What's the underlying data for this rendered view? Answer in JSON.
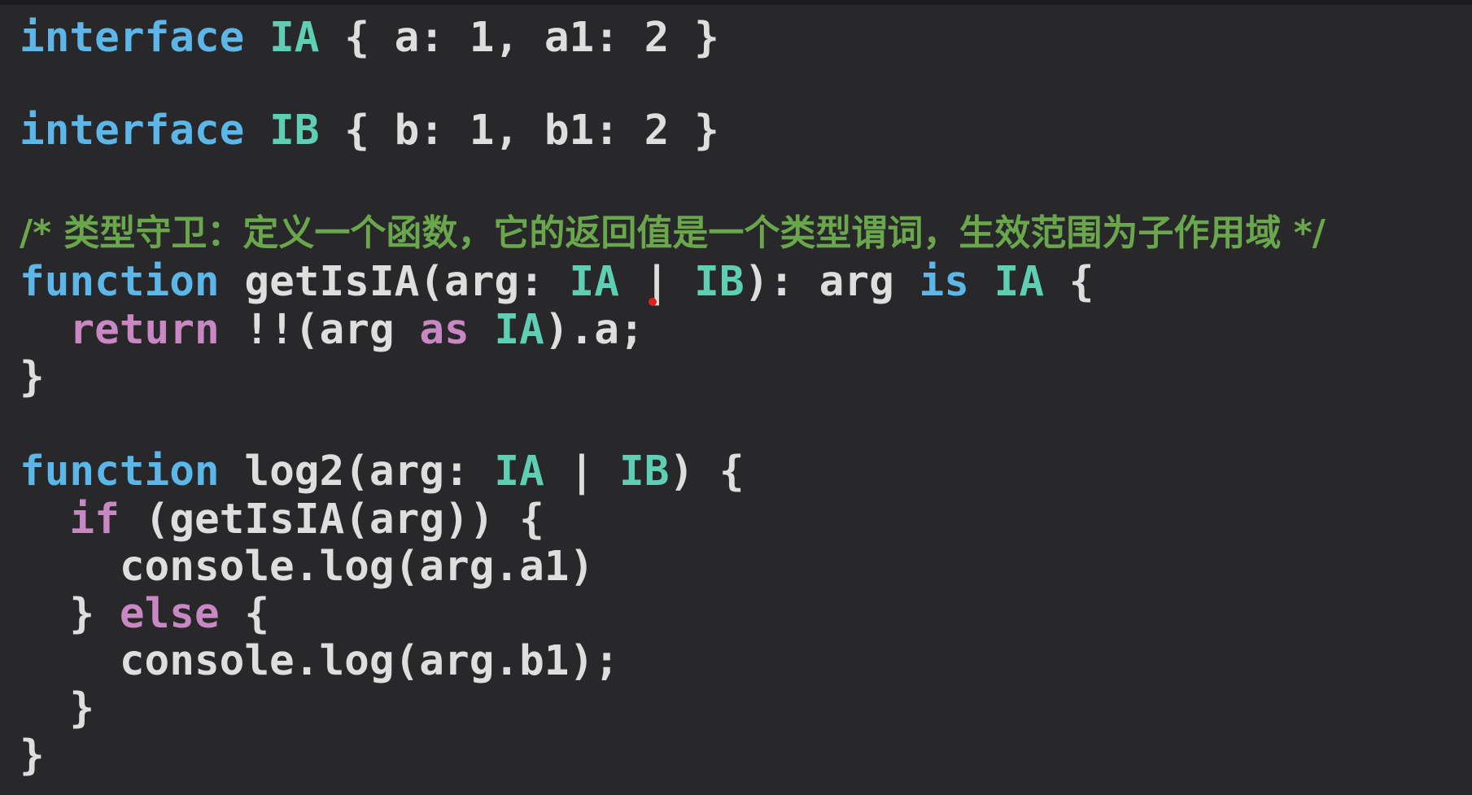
{
  "code": {
    "line1": {
      "kw": "interface",
      "type": "IA",
      "body": "{ a: 1, a1: 2 }"
    },
    "line2": {
      "kw": "interface",
      "type": "IB",
      "body": "{ b: 1, b1: 2 }"
    },
    "line3": {
      "comment": "/* 类型守卫：定义一个函数，它的返回值是一个类型谓词，生效范围为子作用域 */"
    },
    "line4": {
      "kw": "function",
      "name": "getIsIA(arg:",
      "t1": "IA",
      "sep": "|",
      "t2": "IB",
      "mid": "): arg",
      "is": "is",
      "t3": "IA",
      "end": "{"
    },
    "line5": {
      "ret": "return",
      "a": "!!(arg",
      "as": "as",
      "t": "IA",
      "b": ").a;"
    },
    "line6": {
      "close": "}"
    },
    "line7": {
      "kw": "function",
      "name": "log2(arg:",
      "t1": "IA",
      "sep": "|",
      "t2": "IB",
      "end": ") {"
    },
    "line8": {
      "if": "if",
      "rest": "(getIsIA(arg)) {"
    },
    "line9": {
      "text": "console.log(arg.a1)"
    },
    "line10": {
      "close": "}",
      "else": "else",
      "open": "{"
    },
    "line11": {
      "text": "console.log(arg.b1);"
    },
    "line12": {
      "close": "}"
    },
    "line13": {
      "close": "}"
    }
  },
  "colors": {
    "background": "#28282a",
    "keyword": "#5cb6e8",
    "type": "#5fcfb4",
    "control": "#c987c4",
    "text": "#dedede",
    "comment": "#6aa74c",
    "cursor": "#e0201c"
  }
}
